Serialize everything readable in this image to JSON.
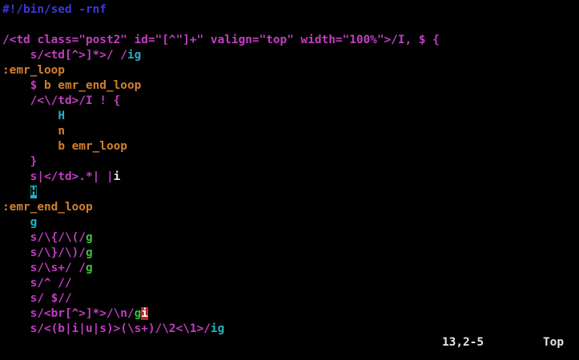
{
  "colors": {
    "background": "#000000",
    "shebang": "#3a3ad6",
    "sed_command": "#c13ec1",
    "label": "#d3802e",
    "cyan": "#27b1c4",
    "green": "#3fbf3f",
    "plain": "#e6e6e6",
    "cursor_bg": "#27b1c4",
    "cursor_fg": "#000000",
    "error_bg": "#c4202a",
    "error_fg": "#ffffff"
  },
  "editor": {
    "lines": [
      {
        "segments": [
          {
            "text": "#!/bin/sed -rnf",
            "color": "shebang"
          }
        ]
      },
      {
        "segments": []
      },
      {
        "segments": [
          {
            "text": "/<td class=\"post2\" id=\"[^\"]+\" valign=\"top\" width=\"100%\">/I, $ {",
            "color": "sed_command"
          }
        ]
      },
      {
        "segments": [
          {
            "text": "    ",
            "color": "plain"
          },
          {
            "text": "s/<td[^>]*>/ /",
            "color": "sed_command"
          },
          {
            "text": "ig",
            "color": "cyan"
          }
        ]
      },
      {
        "segments": [
          {
            "text": ":emr_loop",
            "color": "label"
          }
        ]
      },
      {
        "segments": [
          {
            "text": "    ",
            "color": "plain"
          },
          {
            "text": "$ ",
            "color": "sed_command"
          },
          {
            "text": "b emr_end_loop",
            "color": "label"
          }
        ]
      },
      {
        "segments": [
          {
            "text": "    ",
            "color": "plain"
          },
          {
            "text": "/<\\/td>/I ! {",
            "color": "sed_command"
          }
        ]
      },
      {
        "segments": [
          {
            "text": "        ",
            "color": "plain"
          },
          {
            "text": "H",
            "color": "cyan"
          }
        ]
      },
      {
        "segments": [
          {
            "text": "        ",
            "color": "plain"
          },
          {
            "text": "n",
            "color": "label"
          }
        ]
      },
      {
        "segments": [
          {
            "text": "        ",
            "color": "plain"
          },
          {
            "text": "b emr_loop",
            "color": "label"
          }
        ]
      },
      {
        "segments": [
          {
            "text": "    ",
            "color": "plain"
          },
          {
            "text": "}",
            "color": "sed_command"
          }
        ]
      },
      {
        "segments": [
          {
            "text": "    ",
            "color": "plain"
          },
          {
            "text": "s|</td>.*| |",
            "color": "sed_command"
          },
          {
            "text": "i",
            "color": "plain"
          }
        ]
      },
      {
        "segments": [
          {
            "text": "    ",
            "color": "plain"
          },
          {
            "text": "H",
            "color": "cursor_fg",
            "bg": "cursor_bg",
            "name": "text-cursor"
          }
        ]
      },
      {
        "segments": [
          {
            "text": ":emr_end_loop",
            "color": "label"
          }
        ]
      },
      {
        "segments": [
          {
            "text": "    ",
            "color": "plain"
          },
          {
            "text": "g",
            "color": "cyan"
          }
        ]
      },
      {
        "segments": [
          {
            "text": "    ",
            "color": "plain"
          },
          {
            "text": "s/\\{/\\(/",
            "color": "sed_command"
          },
          {
            "text": "g",
            "color": "green"
          }
        ]
      },
      {
        "segments": [
          {
            "text": "    ",
            "color": "plain"
          },
          {
            "text": "s/\\}/\\)/",
            "color": "sed_command"
          },
          {
            "text": "g",
            "color": "green"
          }
        ]
      },
      {
        "segments": [
          {
            "text": "    ",
            "color": "plain"
          },
          {
            "text": "s/\\s+/ /",
            "color": "sed_command"
          },
          {
            "text": "g",
            "color": "green"
          }
        ]
      },
      {
        "segments": [
          {
            "text": "    ",
            "color": "plain"
          },
          {
            "text": "s/^ //",
            "color": "sed_command"
          }
        ]
      },
      {
        "segments": [
          {
            "text": "    ",
            "color": "plain"
          },
          {
            "text": "s/ $//",
            "color": "sed_command"
          }
        ]
      },
      {
        "segments": [
          {
            "text": "    ",
            "color": "plain"
          },
          {
            "text": "s/<br[^>]*>/\\n/",
            "color": "sed_command"
          },
          {
            "text": "g",
            "color": "green"
          },
          {
            "text": "i",
            "color": "error_fg",
            "bg": "error_bg",
            "name": "error-highlight"
          }
        ]
      },
      {
        "segments": [
          {
            "text": "    ",
            "color": "plain"
          },
          {
            "text": "s/<(b|i|u|s)>(\\s+)/\\2<\\1>/",
            "color": "sed_command"
          },
          {
            "text": "ig",
            "color": "cyan"
          }
        ]
      }
    ]
  },
  "status": {
    "position": "13,2-5",
    "scroll": "Top"
  }
}
